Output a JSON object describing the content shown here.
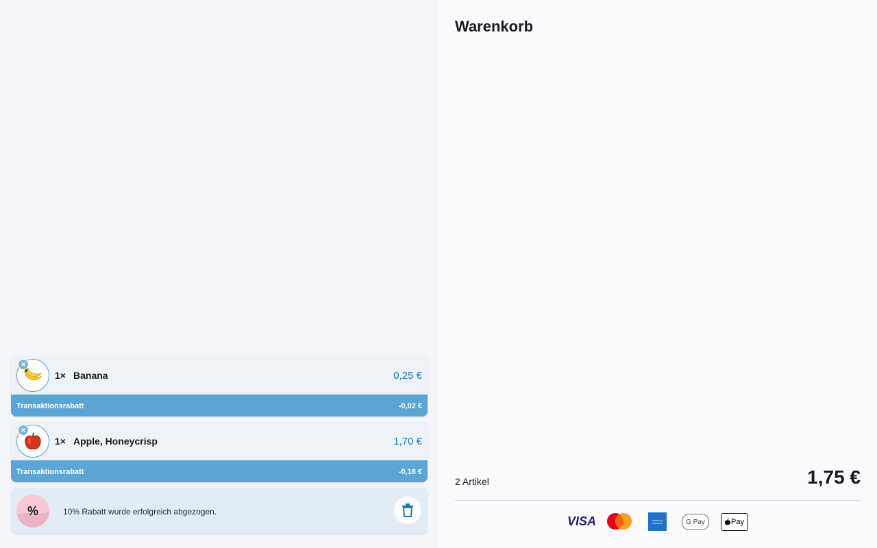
{
  "cart": {
    "items": [
      {
        "qty": "1×",
        "name": "Banana",
        "price": "0,25 €",
        "discount_label": "Transaktionsrabatt",
        "discount_value": "-0,02 €",
        "image": "banana"
      },
      {
        "qty": "1×",
        "name": "Apple, Honeycrisp",
        "price": "1,70 €",
        "discount_label": "Transaktionsrabatt",
        "discount_value": "-0,18 €",
        "image": "apple"
      }
    ],
    "promo": {
      "icon_text": "%",
      "message": "10% Rabatt wurde erfolgreich abgezogen."
    }
  },
  "summary": {
    "title": "Warenkorb",
    "count": "2 Artikel",
    "total": "1,75 €",
    "payment": {
      "visa": "VISA",
      "mastercard": "mastercard-logo",
      "amex": "AMERICAN EXPRESS",
      "gpay": "G Pay",
      "applepay": "Pay"
    }
  },
  "colors": {
    "accent": "#1a7ab2",
    "discount_bar": "#5ba6d4"
  }
}
